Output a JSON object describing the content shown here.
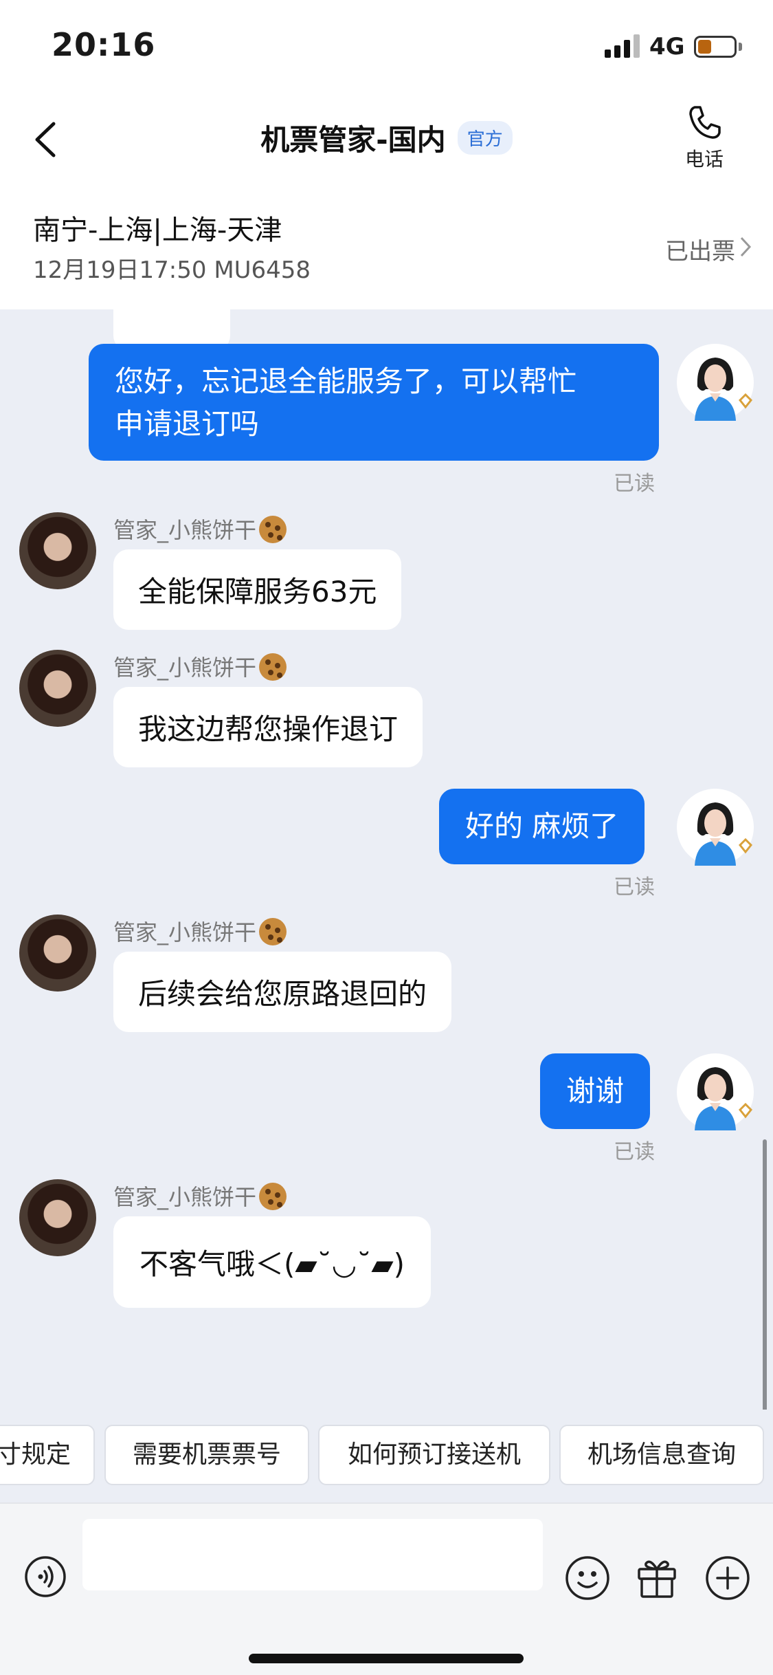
{
  "status_bar": {
    "time": "20:16",
    "network": "4G",
    "battery_level": 0.38,
    "battery_color": "#b8640f"
  },
  "header": {
    "title": "机票管家-国内",
    "badge": "官方",
    "phone_label": "电话",
    "back_icon": "chevron-left-icon",
    "phone_icon": "phone-icon"
  },
  "flight": {
    "route": "南宁-上海|上海-天津",
    "detail": "12月19日17:50 MU6458",
    "status": "已出票"
  },
  "chat": {
    "messages": [
      {
        "from": "user",
        "text_lines": [
          "您好，忘记退全能服务了，可以帮忙",
          "申请退订吗"
        ],
        "read": "已读"
      },
      {
        "from": "agent",
        "name": "管家_小熊饼干",
        "text": "全能保障服务63元"
      },
      {
        "from": "agent",
        "name": "管家_小熊饼干",
        "text": "我这边帮您操作退订"
      },
      {
        "from": "user",
        "text": "好的 麻烦了",
        "read": "已读"
      },
      {
        "from": "agent",
        "name": "管家_小熊饼干",
        "text": "后续会给您原路退回的"
      },
      {
        "from": "user",
        "text": "谢谢",
        "read": "已读"
      },
      {
        "from": "agent",
        "name": "管家_小熊饼干",
        "text": "不客气哦＜(▰˘◡˘▰)"
      }
    ]
  },
  "quick_replies": [
    "寸规定",
    "需要机票票号",
    "如何预订接送机",
    "机场信息查询"
  ],
  "input_bar": {
    "placeholder": "",
    "icons": [
      "voice-icon",
      "emoji-icon",
      "gift-icon",
      "plus-icon"
    ]
  },
  "colors": {
    "accent": "#1471f0",
    "badge_text": "#2b6ed6",
    "chat_background": "#ebeef5"
  }
}
